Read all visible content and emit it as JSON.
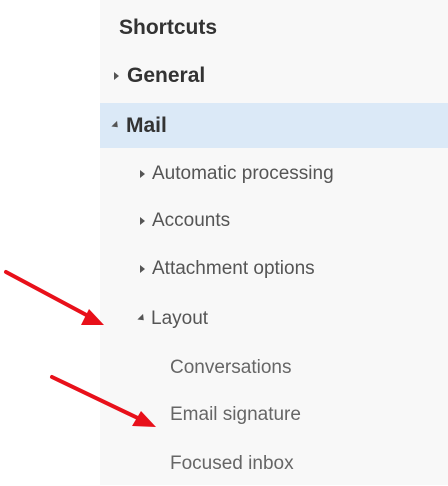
{
  "nav": {
    "shortcuts": {
      "label": "Shortcuts"
    },
    "general": {
      "label": "General",
      "expanded": false
    },
    "mail": {
      "label": "Mail",
      "expanded": true,
      "selected": true,
      "children": [
        {
          "label": "Automatic processing",
          "expanded": false
        },
        {
          "label": "Accounts",
          "expanded": false
        },
        {
          "label": "Attachment options",
          "expanded": false
        },
        {
          "label": "Layout",
          "expanded": true,
          "children": [
            {
              "label": "Conversations"
            },
            {
              "label": "Email signature"
            },
            {
              "label": "Focused inbox"
            }
          ]
        }
      ]
    }
  },
  "colors": {
    "selected_row": "#dbe9f7",
    "panel_background": "#f8f8f8",
    "annotation_arrow": "#e8101a"
  },
  "icons": {
    "collapsed": "triangle-right-icon",
    "expanded": "triangle-expanded-icon",
    "annotation": "red-arrow-icon"
  }
}
